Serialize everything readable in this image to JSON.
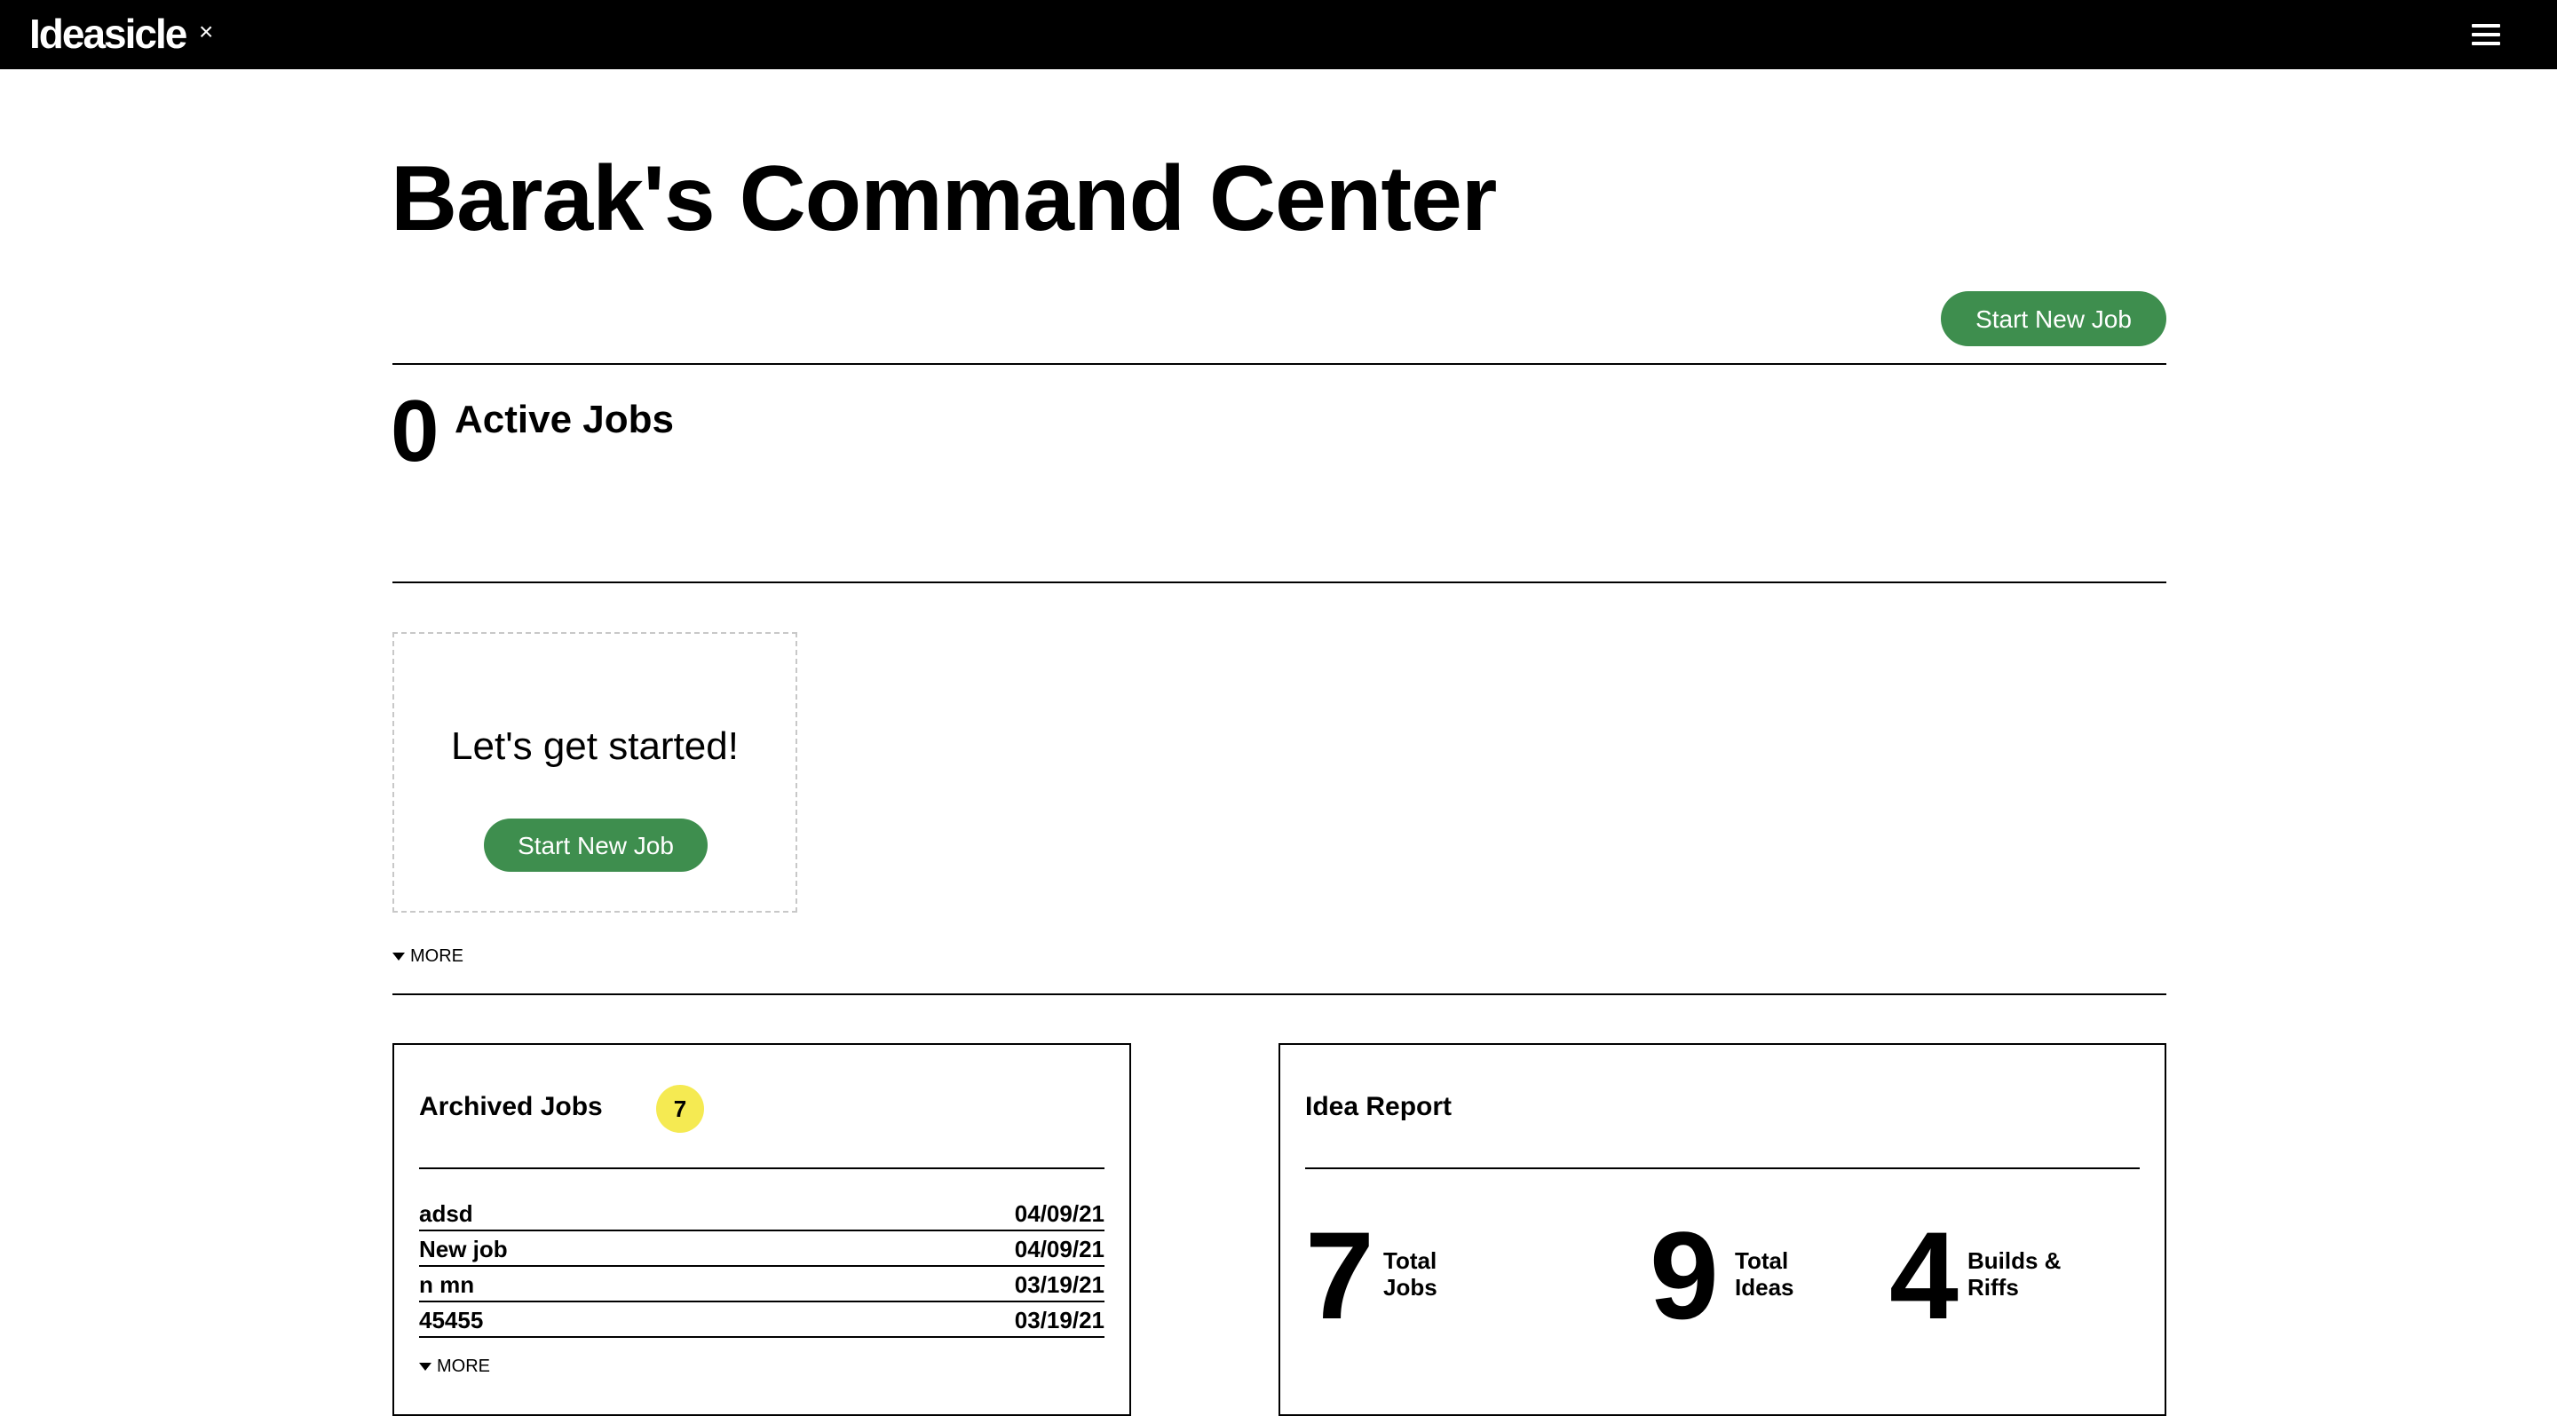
{
  "app": {
    "brand": "Ideasicle",
    "close_glyph": "×"
  },
  "page": {
    "title": "Barak's Command Center"
  },
  "header": {
    "start_new_job_label": "Start New Job"
  },
  "active_jobs": {
    "count": "0",
    "label": "Active Jobs"
  },
  "start_card": {
    "text": "Let's get started!",
    "button_label": "Start New Job"
  },
  "more_label": "MORE",
  "archived": {
    "title": "Archived Jobs",
    "count": "7",
    "rows": [
      {
        "name": "adsd",
        "date": "04/09/21"
      },
      {
        "name": "New job",
        "date": "04/09/21"
      },
      {
        "name": "n mn",
        "date": "03/19/21"
      },
      {
        "name": "45455",
        "date": "03/19/21"
      }
    ],
    "more_label": "MORE"
  },
  "idea_report": {
    "title": "Idea Report",
    "stats": [
      {
        "value": "7",
        "label_line1": "Total",
        "label_line2": "Jobs"
      },
      {
        "value": "9",
        "label_line1": "Total",
        "label_line2": "Ideas"
      },
      {
        "value": "4",
        "label_line1": "Builds &",
        "label_line2": "Riffs"
      }
    ]
  },
  "colors": {
    "accent_green": "#3e8e4e",
    "badge_yellow": "#f5ea52",
    "topbar": "#000000"
  }
}
